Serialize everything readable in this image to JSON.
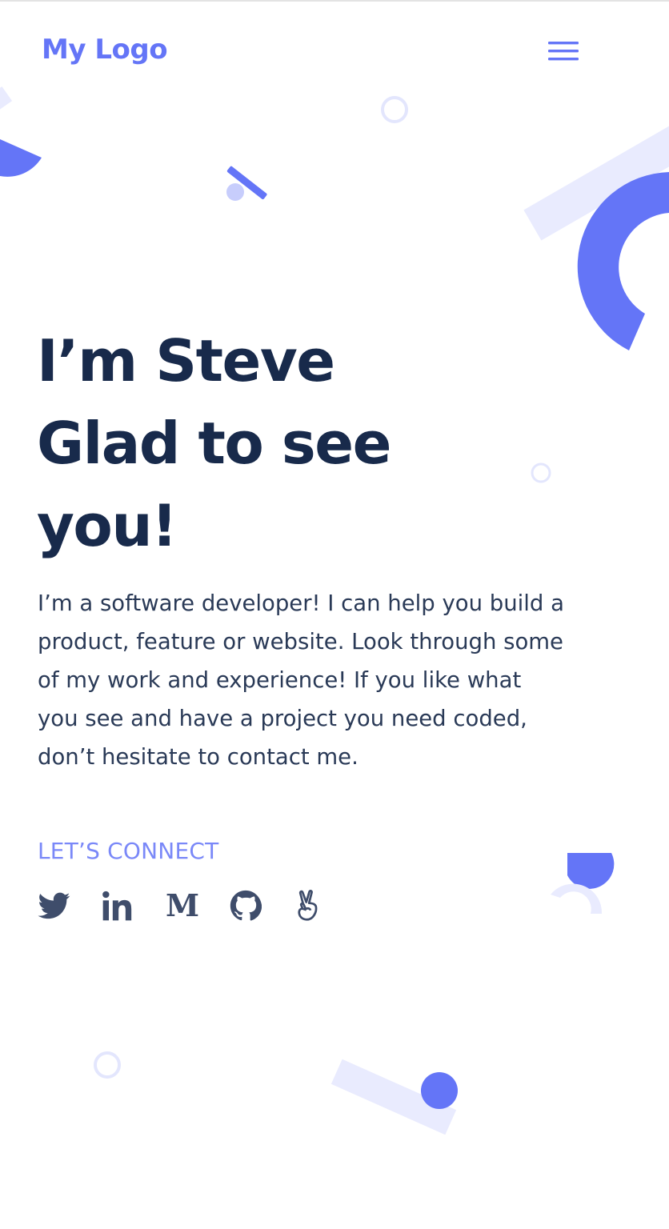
{
  "header": {
    "logo": "My Logo",
    "menu_icon": "hamburger-menu-icon"
  },
  "hero": {
    "title_lines": [
      "I’m Steve",
      "Glad to see",
      "you!"
    ],
    "intro": "I’m a software developer! I can help you build a product, feature or website. Look through some of my work and experience! If you like what you see and have a project you need coded, don’t hesitate to contact me.",
    "connect_label": "LET’S CONNECT"
  },
  "socials": [
    {
      "name": "Twitter",
      "icon": "twitter-icon"
    },
    {
      "name": "LinkedIn",
      "icon": "linkedin-icon"
    },
    {
      "name": "Medium",
      "icon": "medium-icon"
    },
    {
      "name": "GitHub",
      "icon": "github-icon"
    },
    {
      "name": "AngelList",
      "icon": "angellist-icon"
    }
  ],
  "colors": {
    "accent": "#6475f7",
    "accent_light": "#e9ebfe",
    "heading": "#182a4b",
    "body_text": "#2a3a57",
    "connect_label": "#7a88f8",
    "social_icon": "#3f4d6b"
  }
}
